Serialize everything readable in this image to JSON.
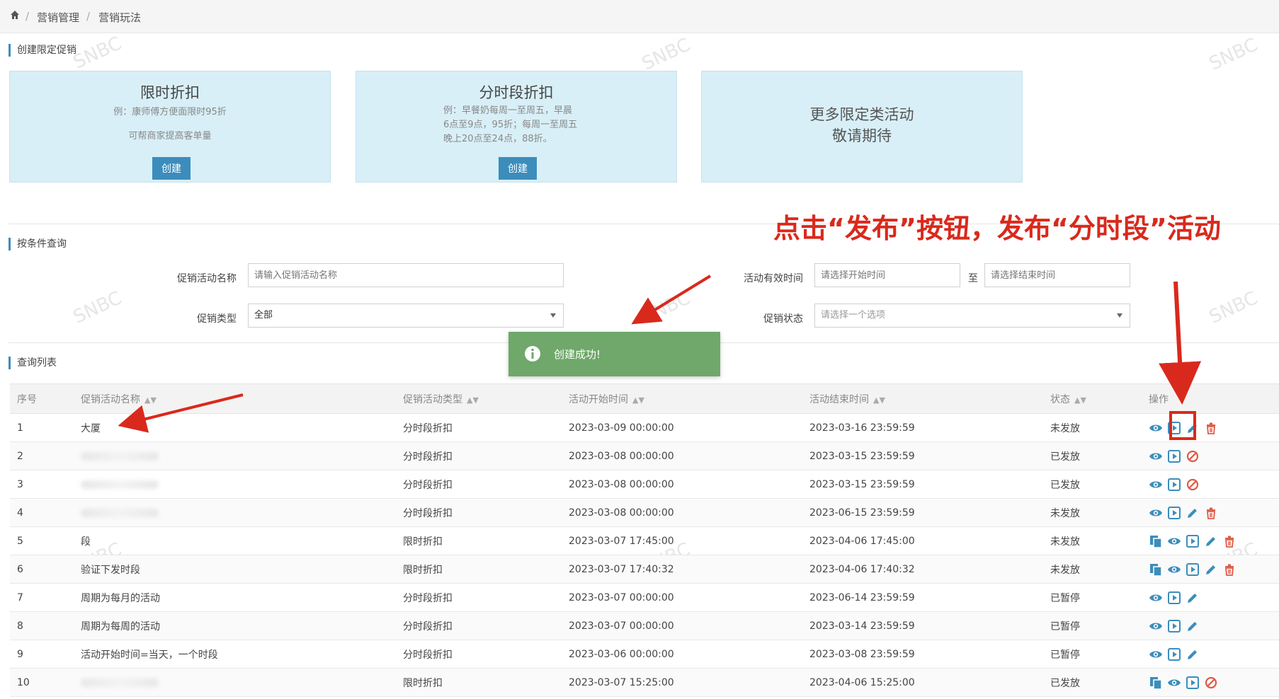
{
  "breadcrumb": [
    "营销管理",
    "营销玩法"
  ],
  "sections": {
    "create": "创建限定促销",
    "query": "按条件查询",
    "list": "查询列表"
  },
  "cards": [
    {
      "title": "限时折扣",
      "desc1": "例：康师傅方便面限时95折",
      "desc2": "可帮商家提高客单量",
      "button": "创建"
    },
    {
      "title": "分时段折扣",
      "desc_lines": [
        "例：早餐奶每周一至周五，早晨",
        "6点至9点，95折；每周一至周五",
        "晚上20点至24点，88折。"
      ],
      "button": "创建"
    },
    {
      "title_lines": [
        "更多限定类活动",
        "敬请期待"
      ]
    }
  ],
  "filters": {
    "name_label": "促销活动名称",
    "name_placeholder": "请输入促销活动名称",
    "time_label": "活动有效时间",
    "start_placeholder": "请选择开始时间",
    "to": "至",
    "end_placeholder": "请选择结束时间",
    "type_label": "促销类型",
    "type_value": "全部",
    "status_label": "促销状态",
    "status_placeholder": "请选择一个选项"
  },
  "toast": {
    "text": "创建成功!"
  },
  "annotation": "点击“发布”按钮，发布“分时段”活动",
  "watermark": "SNBC",
  "table": {
    "headers": [
      "序号",
      "促销活动名称",
      "促销活动类型",
      "活动开始时间",
      "活动结束时间",
      "状态",
      "操作"
    ],
    "rows": [
      {
        "no": "1",
        "name": "大厦",
        "type": "分时段折扣",
        "start": "2023-03-09 00:00:00",
        "end": "2023-03-16 23:59:59",
        "status": "未发放",
        "ops": [
          "view",
          "publish",
          "edit",
          "delete"
        ]
      },
      {
        "no": "2",
        "name": "",
        "type": "分时段折扣",
        "start": "2023-03-08 00:00:00",
        "end": "2023-03-15 23:59:59",
        "status": "已发放",
        "ops": [
          "view",
          "publish",
          "stop"
        ]
      },
      {
        "no": "3",
        "name": "",
        "type": "分时段折扣",
        "start": "2023-03-08 00:00:00",
        "end": "2023-03-15 23:59:59",
        "status": "已发放",
        "ops": [
          "view",
          "publish",
          "stop"
        ]
      },
      {
        "no": "4",
        "name": "",
        "type": "分时段折扣",
        "start": "2023-03-08 00:00:00",
        "end": "2023-06-15 23:59:59",
        "status": "未发放",
        "ops": [
          "view",
          "publish",
          "edit",
          "delete"
        ]
      },
      {
        "no": "5",
        "name": "段",
        "type": "限时折扣",
        "start": "2023-03-07 17:45:00",
        "end": "2023-04-06 17:45:00",
        "status": "未发放",
        "ops": [
          "copy",
          "view",
          "publish",
          "edit",
          "delete"
        ]
      },
      {
        "no": "6",
        "name": "验证下发时段",
        "type": "限时折扣",
        "start": "2023-03-07 17:40:32",
        "end": "2023-04-06 17:40:32",
        "status": "未发放",
        "ops": [
          "copy",
          "view",
          "publish",
          "edit",
          "delete"
        ]
      },
      {
        "no": "7",
        "name": "周期为每月的活动",
        "type": "分时段折扣",
        "start": "2023-03-07 00:00:00",
        "end": "2023-06-14 23:59:59",
        "status": "已暂停",
        "ops": [
          "view",
          "publish",
          "edit"
        ]
      },
      {
        "no": "8",
        "name": "周期为每周的活动",
        "type": "分时段折扣",
        "start": "2023-03-07 00:00:00",
        "end": "2023-03-14 23:59:59",
        "status": "已暂停",
        "ops": [
          "view",
          "publish",
          "edit"
        ]
      },
      {
        "no": "9",
        "name": "活动开始时间=当天，一个时段",
        "type": "分时段折扣",
        "start": "2023-03-06 00:00:00",
        "end": "2023-03-08 23:59:59",
        "status": "已暂停",
        "ops": [
          "view",
          "publish",
          "edit"
        ]
      },
      {
        "no": "10",
        "name": "",
        "type": "限时折扣",
        "start": "2023-03-07 15:25:00",
        "end": "2023-04-06 15:25:00",
        "status": "已发放",
        "ops": [
          "copy",
          "view",
          "publish",
          "stop"
        ]
      }
    ]
  },
  "colors": {
    "primary": "#3c8dbc",
    "card_bg": "#d8eff7",
    "toast": "#6fa86a",
    "annotation": "#d9291c",
    "delete": "#e05a47"
  }
}
